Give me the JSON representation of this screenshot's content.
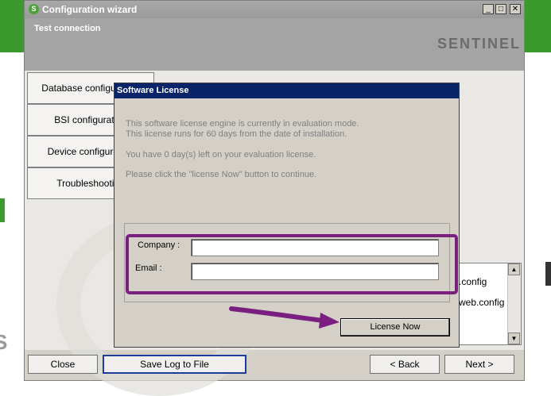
{
  "window": {
    "title": "Configuration wizard",
    "step": "Test connection",
    "brand": "SENTINEL",
    "controls": {
      "minimize": "_",
      "maximize": "□",
      "close": "✕"
    }
  },
  "sidebar": {
    "items": [
      {
        "label": "Database configuration"
      },
      {
        "label": "BSI configuration"
      },
      {
        "label": "Device configuration"
      },
      {
        "label": "Troubleshooting"
      }
    ]
  },
  "file_list": {
    "items": [
      ".config",
      "web.config"
    ]
  },
  "footer": {
    "close": "Close",
    "save_log": "Save Log to File",
    "back": "< Back",
    "next": "Next >"
  },
  "dialog": {
    "title": "Software License",
    "line1": "This software license engine is currently in evaluation mode.",
    "line2": "This license runs for 60 days from the date of installation.",
    "line3": "You have 0 day(s) left on your evaluation license.",
    "line4": "Please click the \"license Now\" button to continue.",
    "company_label": "Company :",
    "company_value": "",
    "email_label": "Email :",
    "email_value": "",
    "license_button": "License Now"
  },
  "annotations": {
    "highlight_color": "#7a1f7f",
    "arrow_color": "#7a1f7f"
  }
}
